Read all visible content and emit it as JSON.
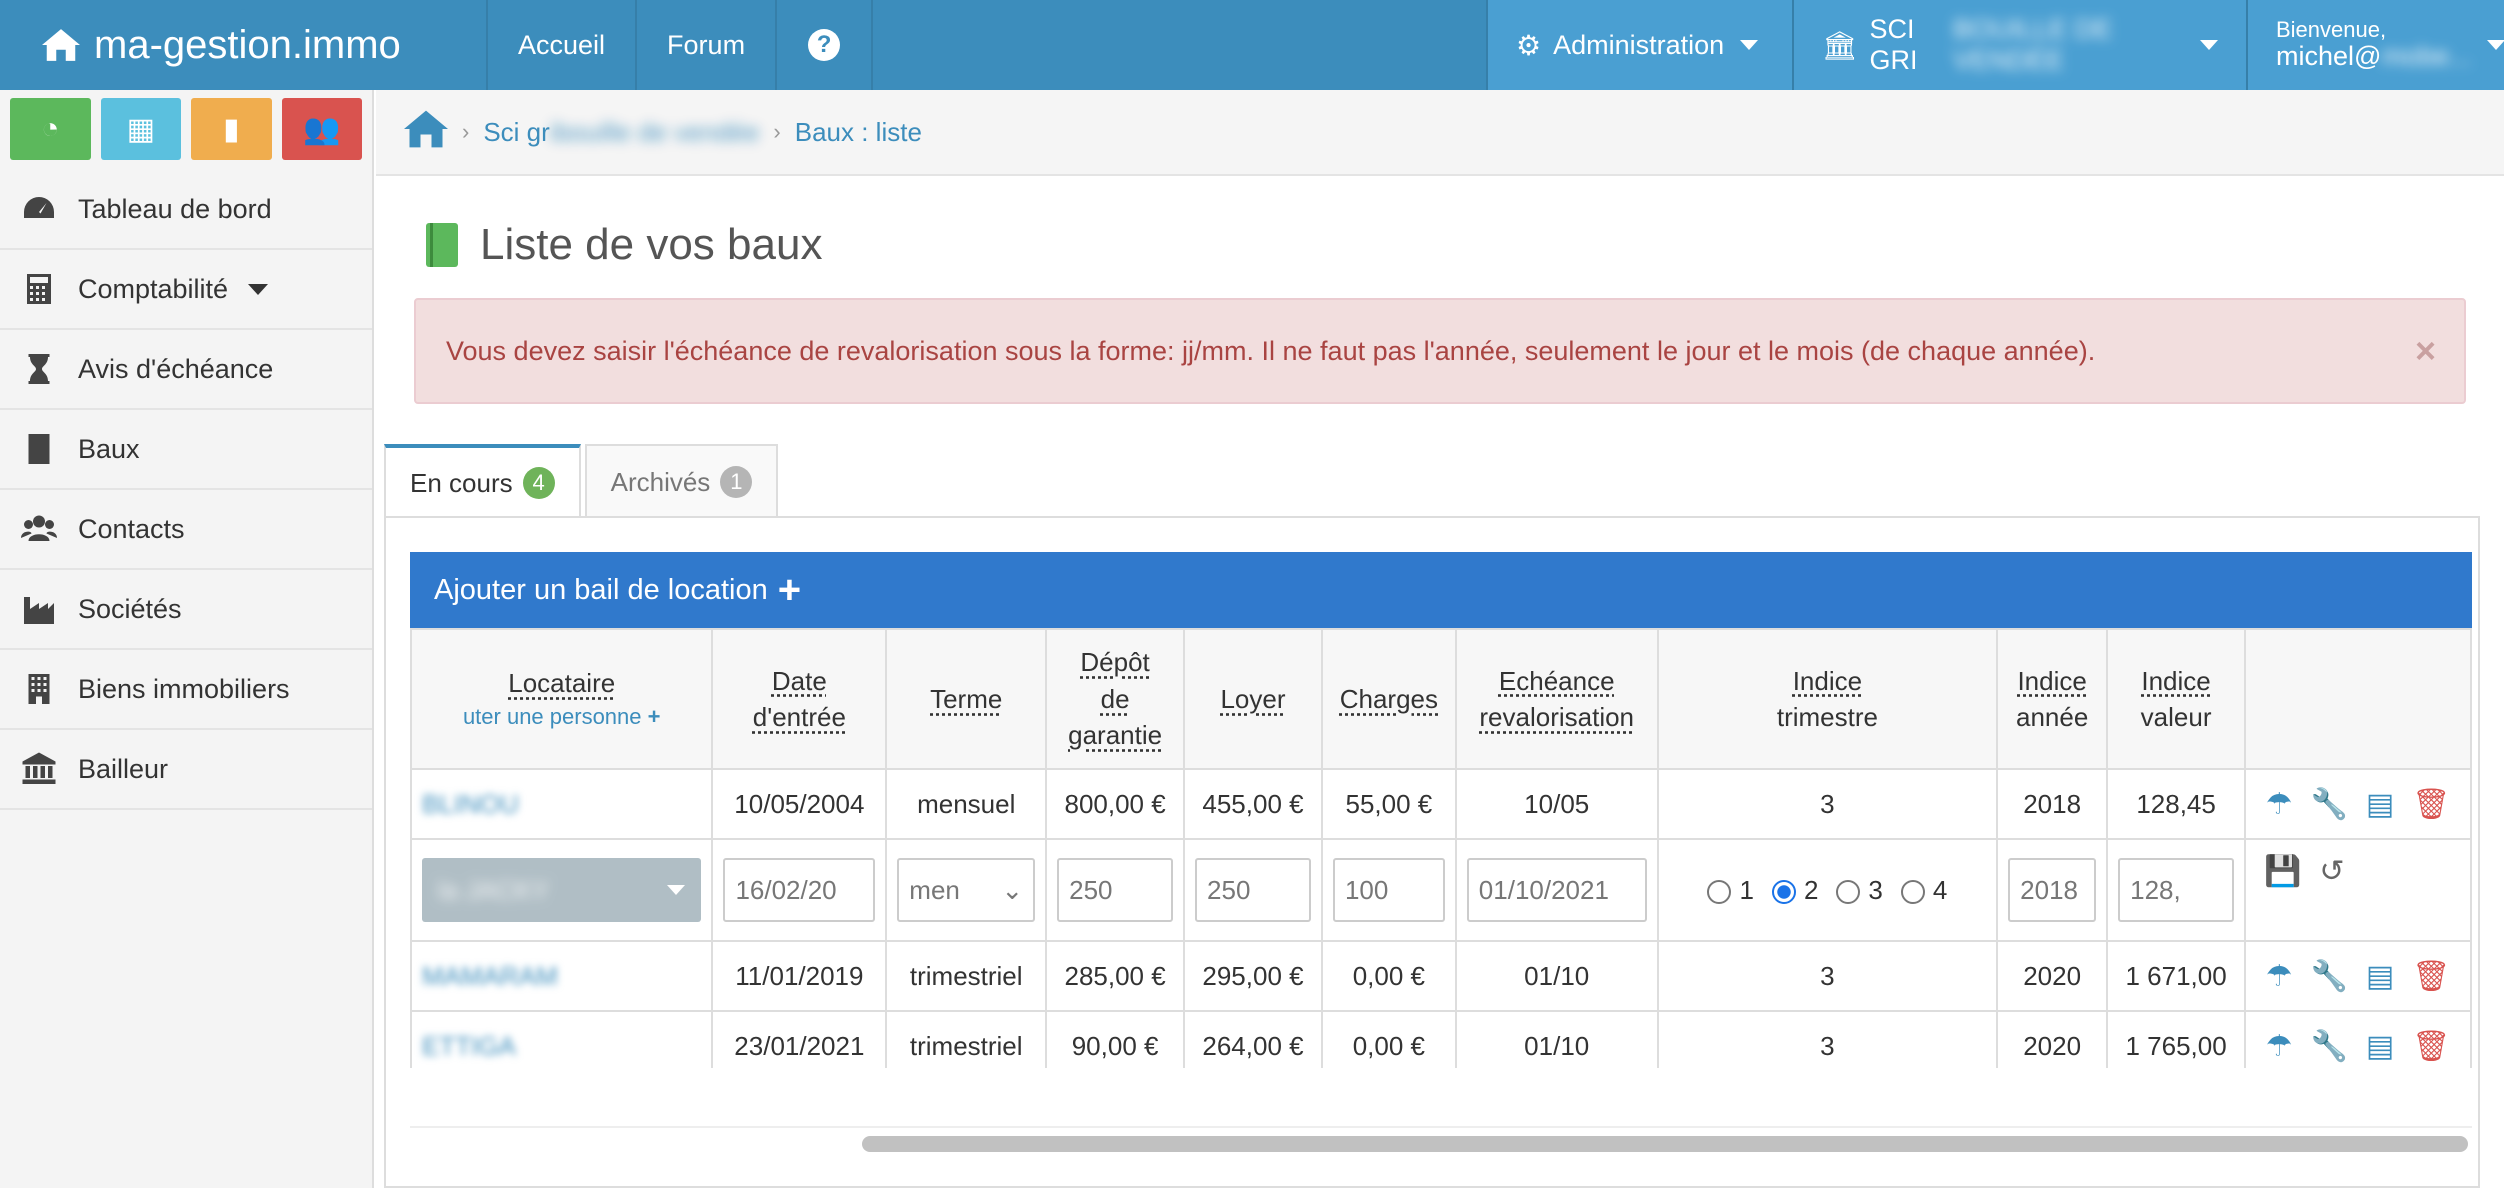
{
  "navbar": {
    "brand": "ma-gestion.immo",
    "links": [
      "Accueil",
      "Forum"
    ],
    "help": "?",
    "admin_label": "Administration",
    "company_label": "SCI GRI",
    "company_label_blurred": "BOUILLE DE VENDÉE",
    "welcome": "Bienvenue,",
    "user": "michel@",
    "user_blurred": "mobe..."
  },
  "quick_buttons": [
    {
      "icon": "dashboard-icon",
      "color": "#5cb85c"
    },
    {
      "icon": "calculator-icon",
      "color": "#5bc0de"
    },
    {
      "icon": "book-icon",
      "color": "#f0ad4e"
    },
    {
      "icon": "users-icon",
      "color": "#d9534f"
    }
  ],
  "sidebar": {
    "items": [
      {
        "label": "Tableau de bord",
        "icon": "dashboard-icon"
      },
      {
        "label": "Comptabilité",
        "icon": "calculator-icon",
        "has_caret": true
      },
      {
        "label": "Avis d'échéance",
        "icon": "hourglass-icon"
      },
      {
        "label": "Baux",
        "icon": "book-icon"
      },
      {
        "label": "Contacts",
        "icon": "users-icon"
      },
      {
        "label": "Sociétés",
        "icon": "industry-icon"
      },
      {
        "label": "Biens immobiliers",
        "icon": "building-icon"
      },
      {
        "label": "Bailleur",
        "icon": "bank-icon"
      }
    ]
  },
  "breadcrumb": {
    "company": "Sci gr",
    "company_blurred": "ibouille de vendée",
    "current": "Baux : liste"
  },
  "page_title": "Liste de vos baux",
  "alert": {
    "message": "Vous devez saisir l'échéance de revalorisation sous la forme: jj/mm. Il ne faut pas l'année, seulement le jour et le mois (de chaque année).",
    "close": "×"
  },
  "tabs": [
    {
      "label": "En cours",
      "count": "4",
      "badge_color": "#6fb35a"
    },
    {
      "label": "Archivés",
      "count": "1",
      "badge_color": "#b5b5b5"
    }
  ],
  "add_lease": {
    "label": "Ajouter un bail de location",
    "plus": "+"
  },
  "table": {
    "headers": {
      "locataire": "Locataire",
      "add_person": "uter une personne",
      "date_line1": "Date",
      "date_line2": "d'entrée",
      "terme": "Terme",
      "depot_line1": "Dépôt",
      "depot_line2": "de",
      "depot_line3": "garantie",
      "loyer": "Loyer",
      "charges": "Charges",
      "echeance_line1": "Echéance",
      "echeance_line2": "revalorisation",
      "indice_tri_line1": "Indice",
      "indice_tri_line2": "trimestre",
      "indice_annee_line1": "Indice",
      "indice_annee_line2": "année",
      "indice_valeur_line1": "Indice",
      "indice_valeur_line2": "valeur"
    },
    "rows": [
      {
        "tenant": "BLINOU",
        "date": "10/05/2004",
        "terme": "mensuel",
        "depot": "800,00 €",
        "loyer": "455,00 €",
        "charges": "55,00 €",
        "echeance": "10/05",
        "trimestre": "3",
        "annee": "2018",
        "valeur": "128,45"
      },
      {
        "tenant": "MAMARAM",
        "date": "11/01/2019",
        "terme": "trimestriel",
        "depot": "285,00 €",
        "loyer": "295,00 €",
        "charges": "0,00 €",
        "echeance": "01/10",
        "trimestre": "3",
        "annee": "2020",
        "valeur": "1 671,00"
      },
      {
        "tenant": "ETTIGA",
        "date": "23/01/2021",
        "terme": "trimestriel",
        "depot": "90,00 €",
        "loyer": "264,00 €",
        "charges": "0,00 €",
        "echeance": "01/10",
        "trimestre": "3",
        "annee": "2020",
        "valeur": "1 765,00"
      }
    ],
    "edit_row": {
      "tenant": "la JACKY",
      "date": "16/02/20",
      "terme": "men",
      "depot": "250",
      "loyer": "250",
      "charges": "100",
      "echeance": "01/10/2021",
      "radios": [
        "1",
        "2",
        "3",
        "4"
      ],
      "radio_selected": "2",
      "annee": "2018",
      "valeur": "128,"
    }
  },
  "scroll": {
    "position_fraction": 0.22
  }
}
